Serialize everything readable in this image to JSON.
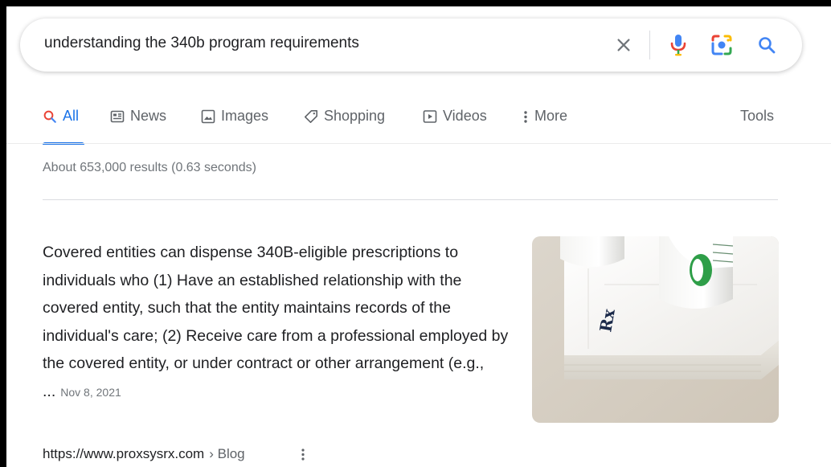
{
  "search": {
    "query": "understanding the 340b program requirements"
  },
  "tabs": [
    {
      "label": "All",
      "icon": "search-icon"
    },
    {
      "label": "News",
      "icon": "news-icon"
    },
    {
      "label": "Images",
      "icon": "image-icon"
    },
    {
      "label": "Shopping",
      "icon": "tag-icon"
    },
    {
      "label": "Videos",
      "icon": "play-icon"
    },
    {
      "label": "More",
      "icon": "more-vertical-icon"
    }
  ],
  "tools_label": "Tools",
  "results_stats": "About 653,000 results (0.63 seconds)",
  "featured_snippet": {
    "text": "Covered entities can dispense 340B-eligible prescriptions to individuals who (1) Have an established relationship with the covered entity, such that the entity maintains records of the individual's care; (2) Receive care from a professional employed by the covered entity, or under contract or other arrangement (e.g., ...",
    "date": "Nov 8, 2021",
    "image_label": "Rx"
  },
  "source": {
    "url": "https://www.proxsysrx.com",
    "breadcrumb": "› Blog"
  },
  "colors": {
    "accent": "#1a73e8",
    "google_blue": "#4285f4",
    "google_red": "#ea4335",
    "google_yellow": "#fbbc04",
    "google_green": "#34a853"
  }
}
